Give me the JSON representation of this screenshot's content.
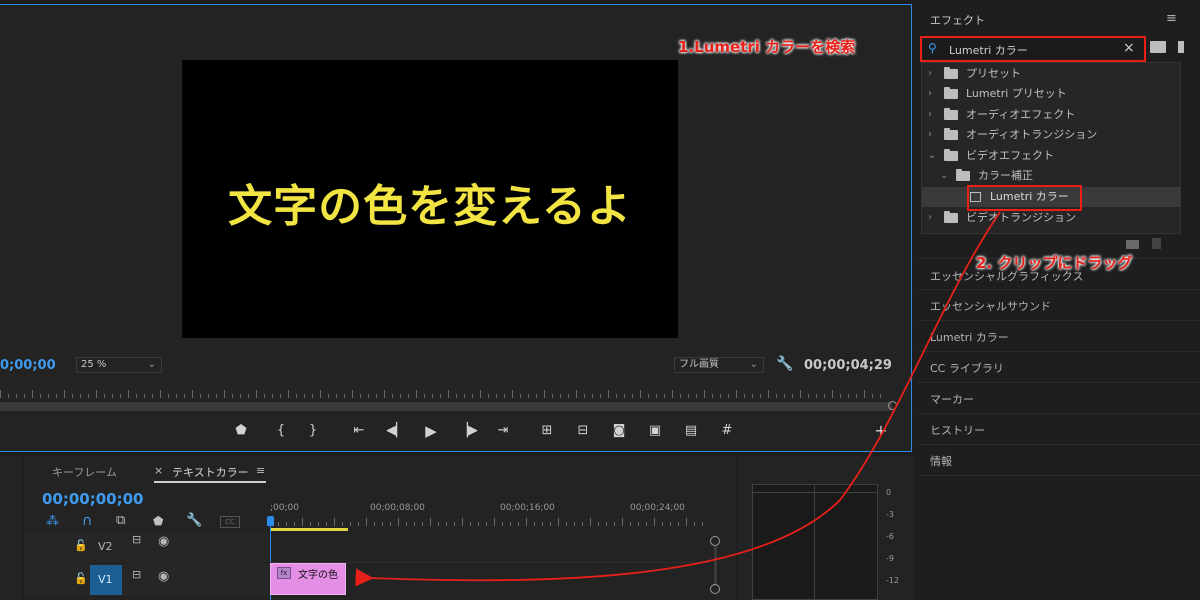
{
  "monitor": {
    "video_text": "文字の色を変えるよ",
    "timecode_left": "0;00;00",
    "zoom": "25 %",
    "quality": "フル画質",
    "timecode_right": "00;00;04;29"
  },
  "timeline": {
    "tab_keyframe": "キーフレーム",
    "tab_sequence_close": "×",
    "tab_sequence": "テキストカラー",
    "tab_menu": "≡",
    "timecode": "00;00;00;00",
    "ruler_labels": [
      ";00;00",
      "00;00;08;00",
      "00;00;16;00",
      "00;00;24;00"
    ],
    "tracks": [
      {
        "label": "V2"
      },
      {
        "label": "V1"
      }
    ],
    "clip_label": "文字の色",
    "clip_fx": "fx"
  },
  "meter": {
    "scale": [
      "0",
      "-3",
      "-6",
      "-9",
      "-12"
    ]
  },
  "effects": {
    "title": "エフェクト",
    "menu": "≡",
    "search_value": "Lumetri カラー",
    "clear": "×",
    "tree": [
      {
        "label": "プリセット"
      },
      {
        "label": "Lumetri プリセット"
      },
      {
        "label": "オーディオエフェクト"
      },
      {
        "label": "オーディオトランジション"
      },
      {
        "label": "ビデオエフェクト"
      },
      {
        "label": "カラー補正"
      },
      {
        "label": "Lumetri カラー"
      },
      {
        "label": "ビデオトランジション"
      }
    ]
  },
  "panels": [
    "エッセンシャルグラフィックス",
    "エッセンシャルサウンド",
    "Lumetri カラー",
    "CC ライブラリ",
    "マーカー",
    "ヒストリー",
    "情報"
  ],
  "annotations": {
    "step1": "1.Lumetri カラーを検索",
    "step2": "2. クリップにドラッグ"
  },
  "colors": {
    "accent": "#2d8ceb",
    "annotation": "#e8201a",
    "title_text": "#f2e543",
    "clip": "#e58ee6"
  }
}
